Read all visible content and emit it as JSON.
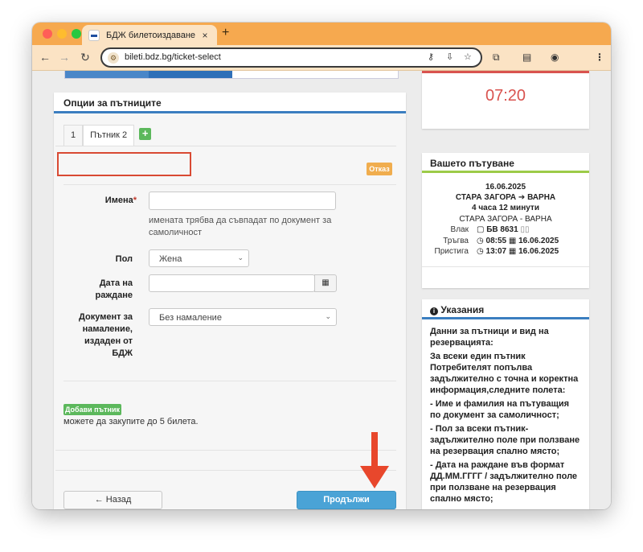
{
  "browser": {
    "tab_title": "БДЖ билетоиздаване",
    "tab_close": "×",
    "new_tab": "+",
    "url": "bileti.bdz.bg/ticket-select"
  },
  "passenger_panel": {
    "heading": "Опции за пътниците",
    "tabs": [
      "1",
      "Пътник 2"
    ],
    "add_tab": "+",
    "cancel_label": "Отказ",
    "fields": {
      "name_label": "Имена",
      "required_mark": "*",
      "name_value": "",
      "name_help": "имената трябва да съвпадат по документ за самоличност",
      "gender_label": "Пол",
      "gender_value": "Жена",
      "birth_label": "Дата на раждане",
      "birth_value": "",
      "discount_label": "Документ за намаление, издаден от БДЖ",
      "discount_value": "Без намаление"
    },
    "add_passenger_label": "Добави пътник",
    "limit_text": "можете да закупите до 5 билета.",
    "back_label": "← Назад",
    "continue_label": "Продължи"
  },
  "timer": {
    "value": "07:20"
  },
  "trip": {
    "heading": "Вашето пътуване",
    "date": "16.06.2025",
    "route": "СТАРА ЗАГОРА ➔ ВАРНА",
    "duration": "4 часа 12 минути",
    "segment": "СТАРА ЗАГОРА - ВАРНА",
    "train_label": "Влак",
    "train_value": "БВ 8631",
    "depart_label": "Тръгва",
    "depart_time": "08:55",
    "depart_date": "16.06.2025",
    "arrive_label": "Пристига",
    "arrive_time": "13:07",
    "arrive_date": "16.06.2025"
  },
  "notes": {
    "heading": "Указания",
    "paragraphs": [
      "Данни за пътници и вид на резервацията:",
      "За всеки един пътник Потребителят попълва задължително с точна и коректна информация,следните полета:",
      "- Име и фамилия на пътуващия по документ за самоличност;",
      "- Пол за всеки пътник- задължително поле при ползване на резервация спално място;",
      "- Дата на раждане във формат ДД.ММ.ГГГГ / задължително поле при ползване на резервация спално място;"
    ]
  },
  "colors": {
    "tab_strip": "#f6a94f",
    "toolbar": "#fbe3c4",
    "accent_blue": "#3b7ec0",
    "accent_green": "#9ccb48",
    "timer_red": "#d9534f",
    "annotation_red": "#e8472c",
    "continue_button": "#4aa3d6"
  }
}
